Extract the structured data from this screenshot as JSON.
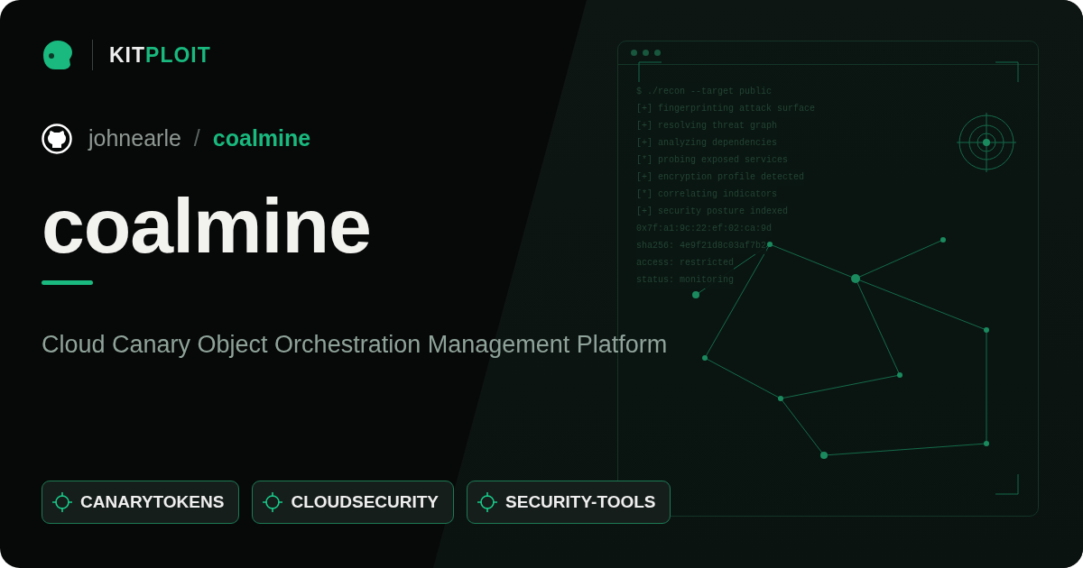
{
  "brand": {
    "prefix": "KIT",
    "suffix": "PLOIT"
  },
  "repo": {
    "owner": "johnearle",
    "separator": "/",
    "name": "coalmine"
  },
  "title": "coalmine",
  "description": "Cloud Canary Object Orchestration Management Platform",
  "tags": [
    {
      "label": "CANARYTOKENS"
    },
    {
      "label": "CLOUDSECURITY"
    },
    {
      "label": "SECURITY-TOOLS"
    }
  ],
  "terminal": {
    "lines": [
      "$ ./recon --target public",
      "[+] fingerprinting attack surface",
      "[+] resolving threat graph",
      "[+] analyzing dependencies",
      "[*] probing exposed services",
      "[+] encryption profile detected",
      "[*] correlating indicators",
      "[+] security posture indexed",
      "0x7f:a1:9c:22:ef:02:ca:9d",
      "sha256: 4e9f21d8c03af7b2",
      "access: restricted",
      "status: monitoring"
    ]
  }
}
